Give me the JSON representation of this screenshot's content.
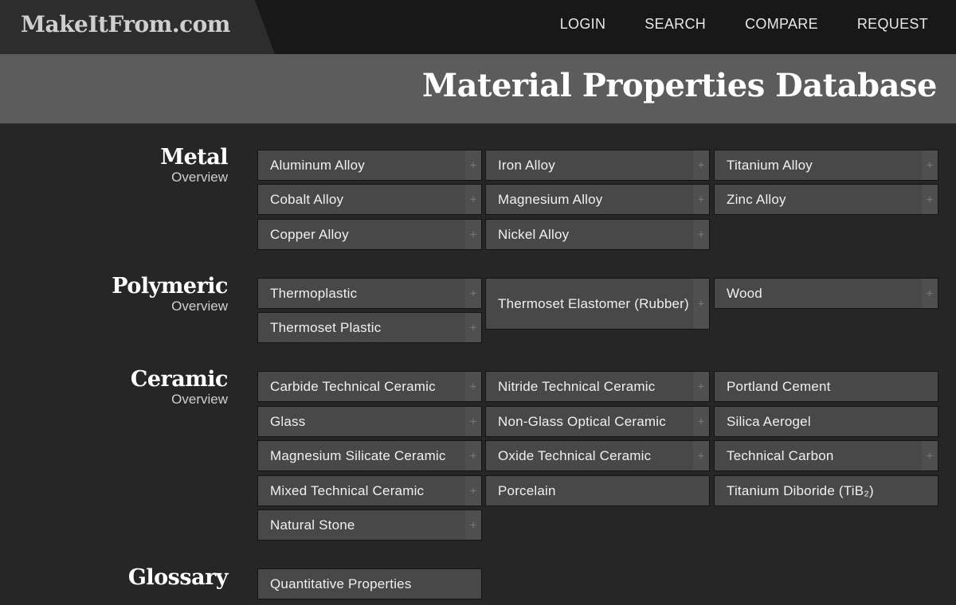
{
  "site": {
    "logo": "MakeItFrom.com"
  },
  "nav": {
    "login": "LOGIN",
    "search": "SEARCH",
    "compare": "COMPARE",
    "request": "REQUEST"
  },
  "banner": {
    "title": "Material Properties Database"
  },
  "icons": {
    "expand": "plus-icon"
  },
  "colors": {
    "background": "#262626",
    "cell": "#484848",
    "banner": "#5c5c5c",
    "topbar": "#181818"
  },
  "sections": {
    "metal": {
      "title": "Metal",
      "overview": "Overview",
      "items": [
        "Aluminum Alloy",
        "Iron Alloy",
        "Titanium Alloy",
        "Cobalt Alloy",
        "Magnesium Alloy",
        "Zinc Alloy",
        "Copper Alloy",
        "Nickel Alloy"
      ]
    },
    "polymeric": {
      "title": "Polymeric",
      "overview": "Overview",
      "items": [
        "Thermoplastic",
        "Thermoset Elastomer (Rubber)",
        "Wood",
        "Thermoset Plastic"
      ]
    },
    "ceramic": {
      "title": "Ceramic",
      "overview": "Overview",
      "items": [
        "Carbide Technical Ceramic",
        "Nitride Technical Ceramic",
        "Portland Cement",
        "Glass",
        "Non-Glass Optical Ceramic",
        "Silica Aerogel",
        "Magnesium Silicate Ceramic",
        "Oxide Technical Ceramic",
        "Technical Carbon",
        "Mixed Technical Ceramic",
        "Porcelain",
        "Titanium Diboride (TiB₂)",
        "Natural Stone"
      ]
    },
    "glossary": {
      "title": "Glossary",
      "items": [
        "Quantitative Properties"
      ]
    }
  },
  "plus_symbol": "+"
}
